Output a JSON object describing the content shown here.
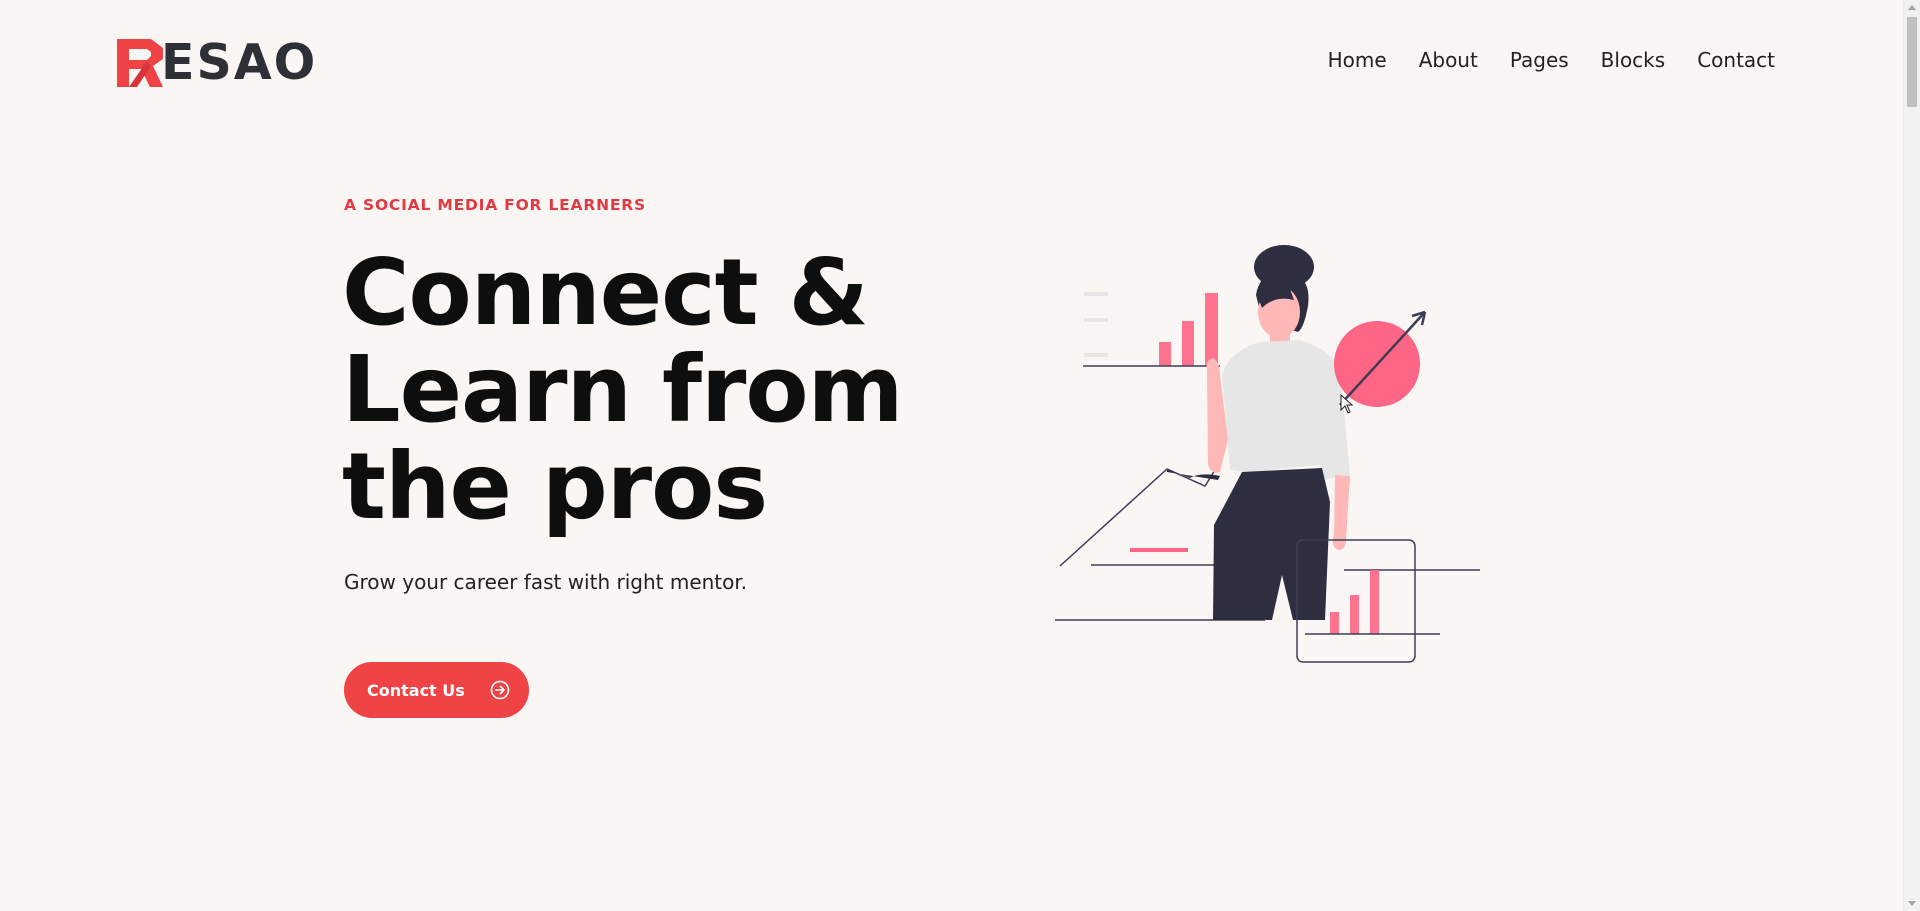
{
  "brand": {
    "logo_text": "ESAO",
    "logo_mark_letter": "R",
    "logo_mark_icon": "r-logo-icon",
    "accent_color": "#ef4346"
  },
  "nav": {
    "items": [
      {
        "label": "Home"
      },
      {
        "label": "About"
      },
      {
        "label": "Pages"
      },
      {
        "label": "Blocks"
      },
      {
        "label": "Contact"
      }
    ]
  },
  "hero": {
    "eyebrow": "A SOCIAL MEDIA FOR LEARNERS",
    "headline_lines": [
      "Connect &",
      "Learn from",
      "the pros"
    ],
    "subtitle": "Grow your career fast with right mentor.",
    "cta_label": "Contact Us",
    "cta_icon": "circle-arrow-right-icon",
    "illustration_icon": "woman-with-growth-charts-illustration"
  },
  "colors": {
    "background": "#f9f6f4",
    "headline": "#0e0e0e",
    "eyebrow": "#e03b44",
    "pink_circle": "#ff6584",
    "dark_figure": "#2f2e41"
  }
}
